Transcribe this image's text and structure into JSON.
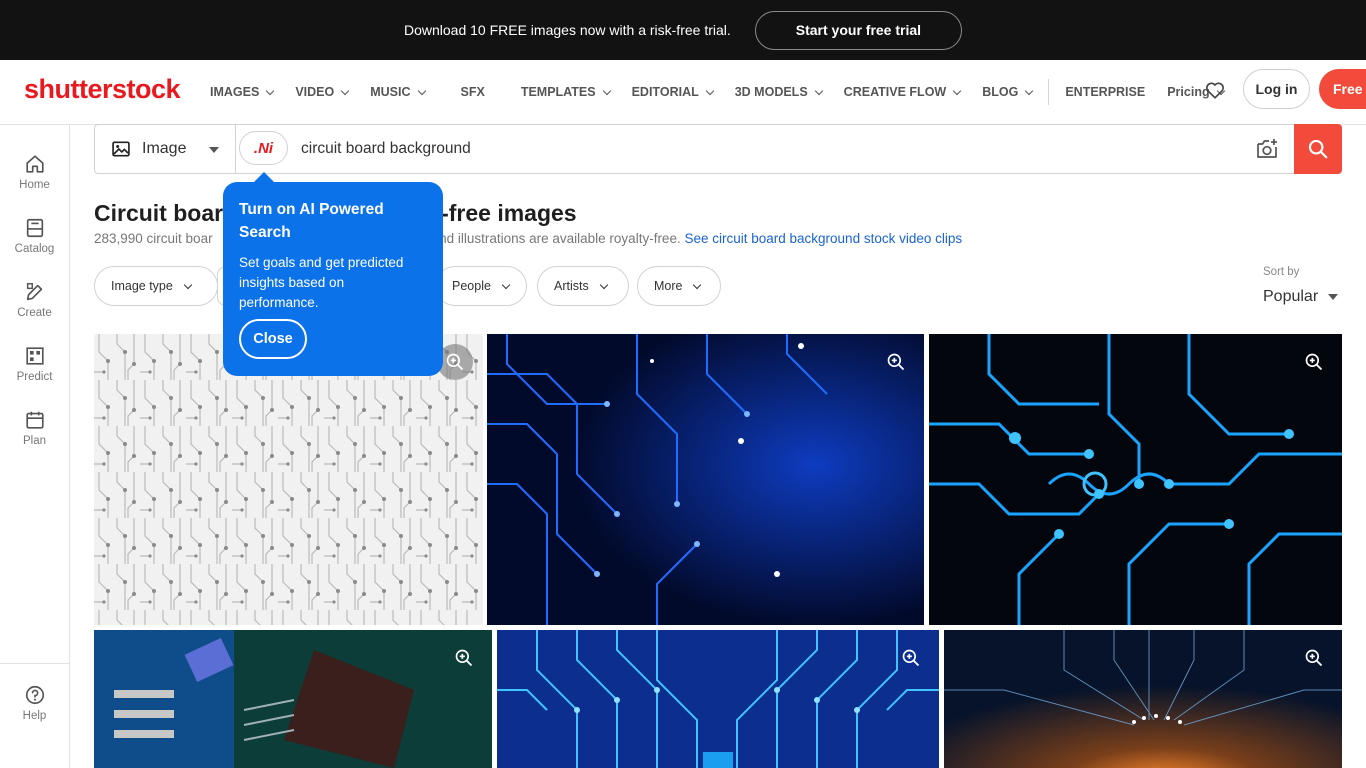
{
  "promo": {
    "text": "Download 10 FREE images now with a risk-free trial.",
    "cta": "Start your free trial"
  },
  "header": {
    "logo": "shutterstock",
    "nav": [
      "IMAGES",
      "VIDEO",
      "MUSIC",
      "SFX",
      "TEMPLATES",
      "EDITORIAL",
      "3D MODELS",
      "CREATIVE FLOW",
      "BLOG",
      "ENTERPRISE",
      "Pricing"
    ],
    "login": "Log in",
    "free_trial": "Free t"
  },
  "rail": {
    "home": "Home",
    "catalog": "Catalog",
    "create": "Create",
    "predict": "Predict",
    "plan": "Plan",
    "help": "Help"
  },
  "search": {
    "type": "Image",
    "ai_label": ".Ni",
    "query": "circuit board background"
  },
  "results": {
    "title_start": "Circuit boar",
    "title_end": "-free images",
    "count_start": "283,990 circuit boar",
    "count_end": "and illustrations are available royalty-free.",
    "video_link": "See circuit board background stock video clips"
  },
  "filters": {
    "image_type": "Image type",
    "people": "People",
    "artists": "Artists",
    "more": "More"
  },
  "sort": {
    "label": "Sort by",
    "value": "Popular"
  },
  "popover": {
    "title": "Turn on AI Powered Search",
    "body": "Set goals and get predicted insights based on performance.",
    "close": "Close"
  },
  "colors": {
    "brand_red": "#e8191f",
    "cta_red": "#f24b3c",
    "popover_blue": "#0b72ea",
    "link_blue": "#1a63d6"
  }
}
